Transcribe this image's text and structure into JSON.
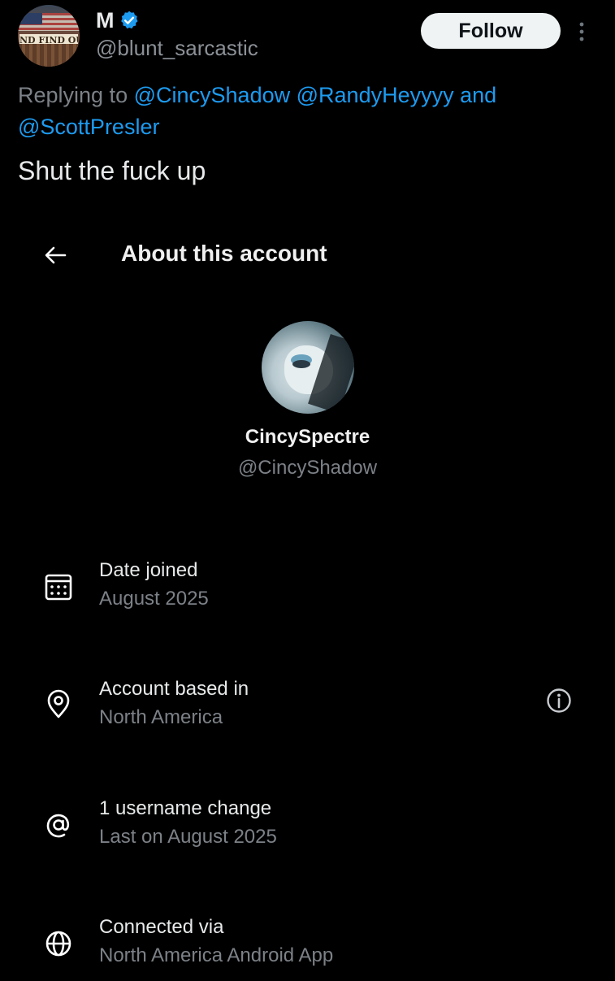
{
  "tweet": {
    "avatar": {
      "sign_text": "ND FIND OU"
    },
    "display_name": "M",
    "handle": "@blunt_sarcastic",
    "follow_label": "Follow",
    "replying_prefix": "Replying to",
    "mentions": [
      "@CincyShadow",
      "@RandyHeyyyy"
    ],
    "mentions_joiner": "and",
    "last_mention": "@ScottPresler",
    "text": "Shut the fuck up"
  },
  "about": {
    "title": "About this account",
    "profile_name": "CincySpectre",
    "profile_handle": "@CincyShadow",
    "items": [
      {
        "icon": "calendar-icon",
        "label": "Date joined",
        "value": "August 2025"
      },
      {
        "icon": "location-pin-icon",
        "label": "Account based in",
        "value": "North America"
      },
      {
        "icon": "at-sign-icon",
        "label": "1 username change",
        "value": "Last on August 2025"
      },
      {
        "icon": "globe-icon",
        "label": "Connected via",
        "value": "North America Android App"
      }
    ]
  },
  "colors": {
    "background": "#000000",
    "primary_text": "#e7e9ea",
    "secondary_text": "#7c8187",
    "mention": "#1d9bf0",
    "verified_badge": "#1d9bf0",
    "follow_button_bg": "#eff3f4"
  }
}
